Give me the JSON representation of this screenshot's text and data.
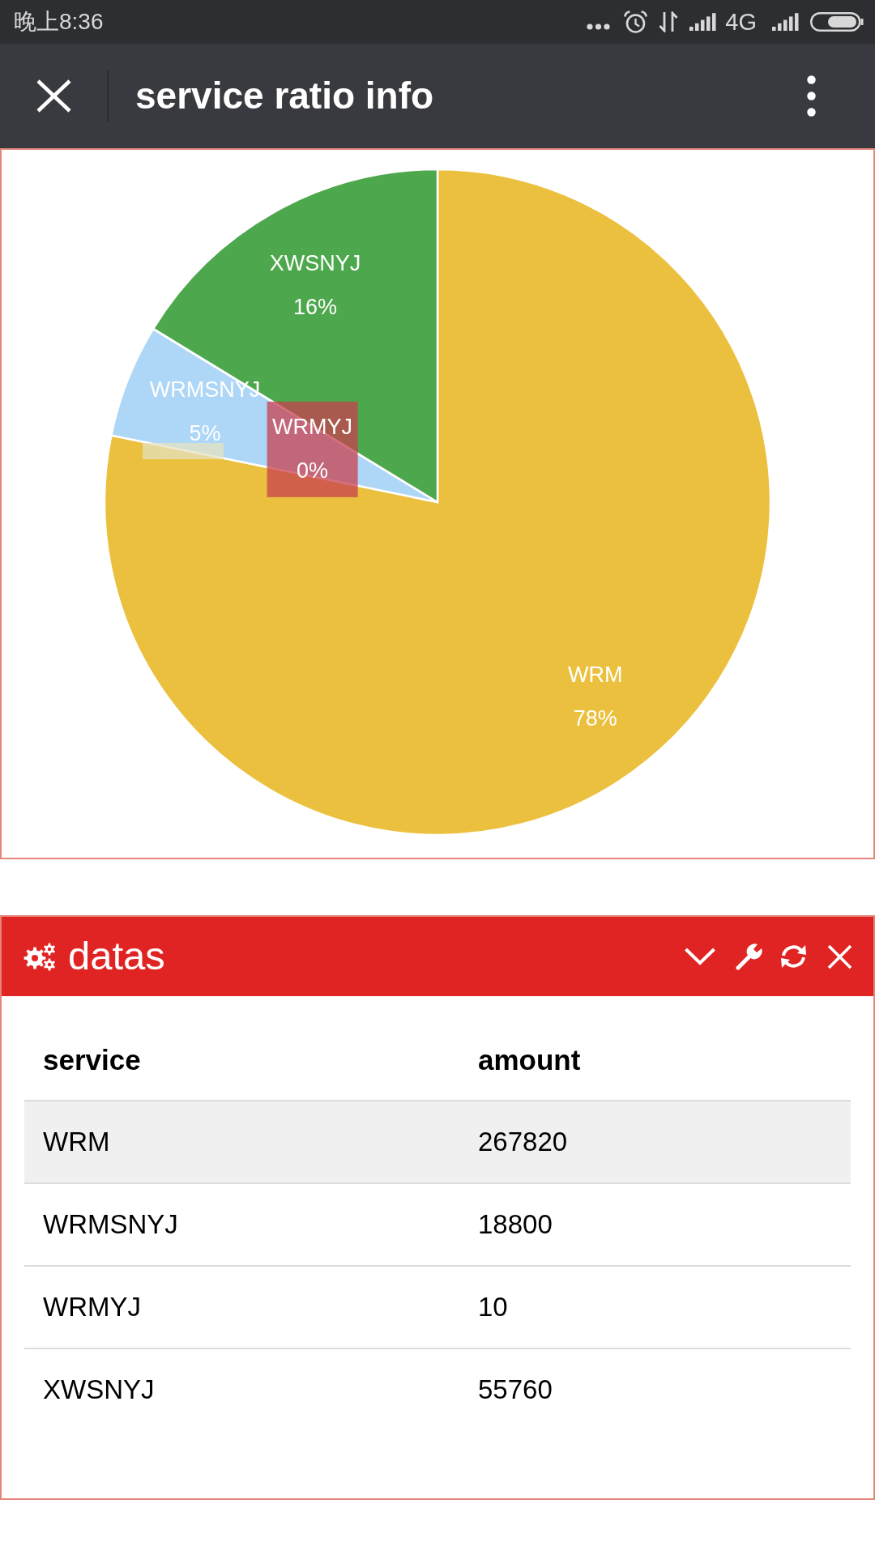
{
  "status_bar": {
    "time": "晚上8:36",
    "network": "4G"
  },
  "title_bar": {
    "title": "service ratio info"
  },
  "chart": {
    "chart_data": {
      "type": "pie",
      "categories": [
        "WRM",
        "WRMSNYJ",
        "WRMYJ",
        "XWSNYJ"
      ],
      "values": [
        78.22,
        5.49,
        0.01,
        16.28
      ],
      "colors": [
        "#ecc03f",
        "#aed6f6",
        "#c8404f",
        "#4da84d"
      ],
      "value_labels": [
        "78%",
        "5%",
        "0%",
        "16%"
      ]
    }
  },
  "panel": {
    "title": "datas",
    "table": {
      "columns": [
        "service",
        "amount"
      ],
      "rows": [
        {
          "cells": [
            "WRM",
            "267820"
          ],
          "selected": true
        },
        {
          "cells": [
            "WRMSNYJ",
            "18800"
          ],
          "selected": false
        },
        {
          "cells": [
            "WRMYJ",
            "10"
          ],
          "selected": false
        },
        {
          "cells": [
            "XWSNYJ",
            "55760"
          ],
          "selected": false
        }
      ]
    }
  }
}
